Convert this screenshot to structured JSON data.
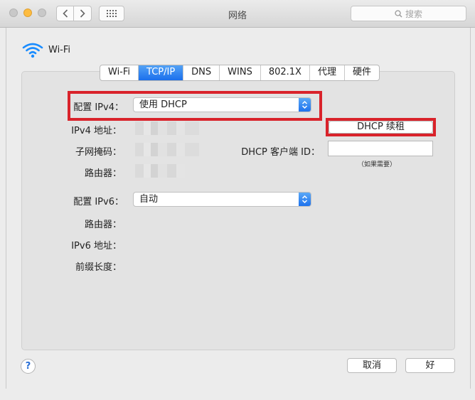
{
  "window": {
    "title": "网络"
  },
  "toolbar": {
    "back_icon": "chevron-left-icon",
    "forward_icon": "chevron-right-icon",
    "grid_icon": "grid-icon",
    "search_placeholder": "搜索"
  },
  "interface": {
    "name": "Wi-Fi"
  },
  "tabs": [
    {
      "label": "Wi-Fi",
      "active": false
    },
    {
      "label": "TCP/IP",
      "active": true
    },
    {
      "label": "DNS",
      "active": false
    },
    {
      "label": "WINS",
      "active": false
    },
    {
      "label": "802.1X",
      "active": false
    },
    {
      "label": "代理",
      "active": false
    },
    {
      "label": "硬件",
      "active": false
    }
  ],
  "ipv4": {
    "config_label": "配置 IPv4：",
    "config_value": "使用 DHCP",
    "address_label": "IPv4 地址：",
    "subnet_label": "子网掩码：",
    "router_label": "路由器：",
    "renew_button": "DHCP 续租",
    "client_id_label": "DHCP 客户端 ID：",
    "client_id_value": "",
    "client_id_hint": "（如果需要）"
  },
  "ipv6": {
    "config_label": "配置 IPv6：",
    "config_value": "自动",
    "router_label": "路由器：",
    "address_label": "IPv6 地址：",
    "prefix_label": "前缀长度："
  },
  "footer": {
    "help": "?",
    "cancel": "取消",
    "ok": "好"
  },
  "colors": {
    "accent": "#1b6fec",
    "highlight": "#d9232b"
  }
}
